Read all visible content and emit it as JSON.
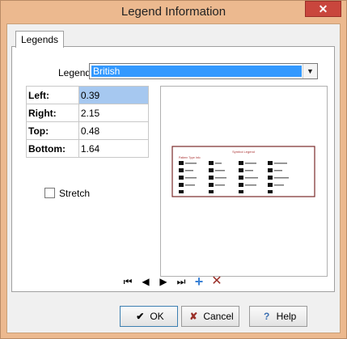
{
  "window": {
    "title": "Legend Information"
  },
  "tabs": [
    {
      "label": "Legends"
    }
  ],
  "legend": {
    "label": "Legend:",
    "value": "British"
  },
  "margins": [
    {
      "label": "Left:",
      "value": "0.39"
    },
    {
      "label": "Right:",
      "value": "2.15"
    },
    {
      "label": "Top:",
      "value": "0.48"
    },
    {
      "label": "Bottom:",
      "value": "1.64"
    }
  ],
  "stretch": {
    "label": "Stretch",
    "checked": false
  },
  "preview": {
    "title": "Symbol Legend",
    "subtitle": "Pattern Type Info"
  },
  "buttons": {
    "ok": "OK",
    "cancel": "Cancel",
    "help": "Help"
  },
  "colors": {
    "selection": "#3399ff",
    "add": "#3b82d6",
    "delete": "#9a2f28",
    "preview_border": "#7a2a2a"
  }
}
